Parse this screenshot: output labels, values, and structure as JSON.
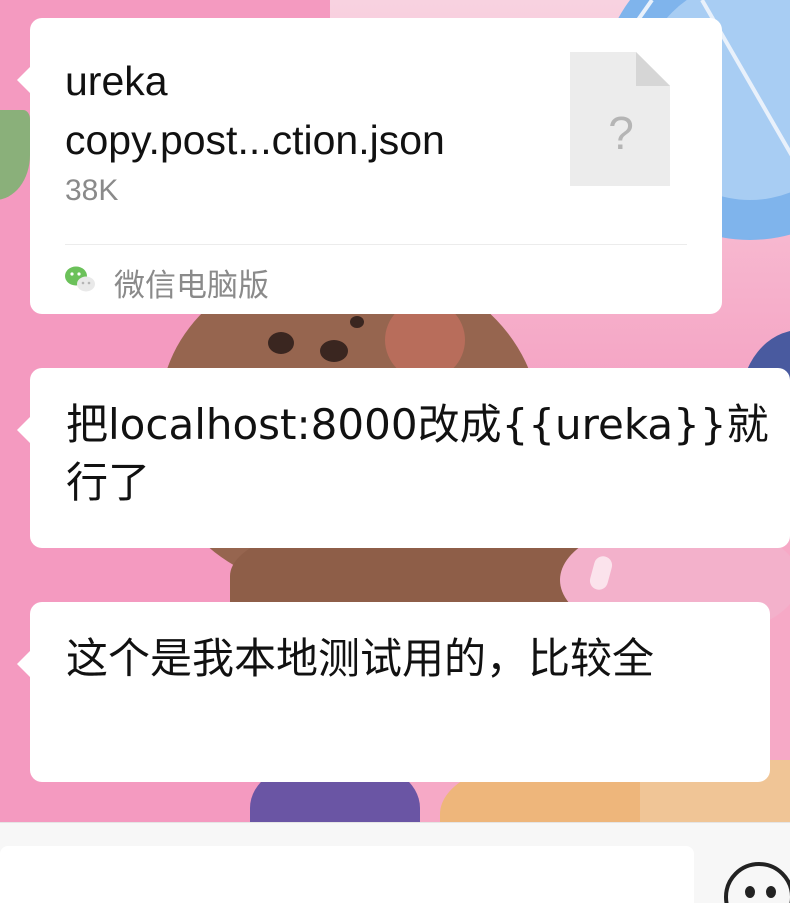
{
  "file_message": {
    "name_line1": "ureka",
    "name_line2": "copy.post...ction.json",
    "size": "38K",
    "thumbnail_glyph": "?",
    "source": "微信电脑版",
    "source_icon": "wechat-icon"
  },
  "messages": [
    {
      "text": "把localhost:8000改成{{ureka}}就行了"
    },
    {
      "text": "这个是我本地测试用的，比较全"
    }
  ],
  "input": {
    "value": "",
    "emoji_icon": "smiley-icon"
  },
  "colors": {
    "bubble": "#ffffff",
    "wechat_green": "#6bc15a",
    "text": "#111111",
    "meta_text": "#8a8a8a"
  }
}
